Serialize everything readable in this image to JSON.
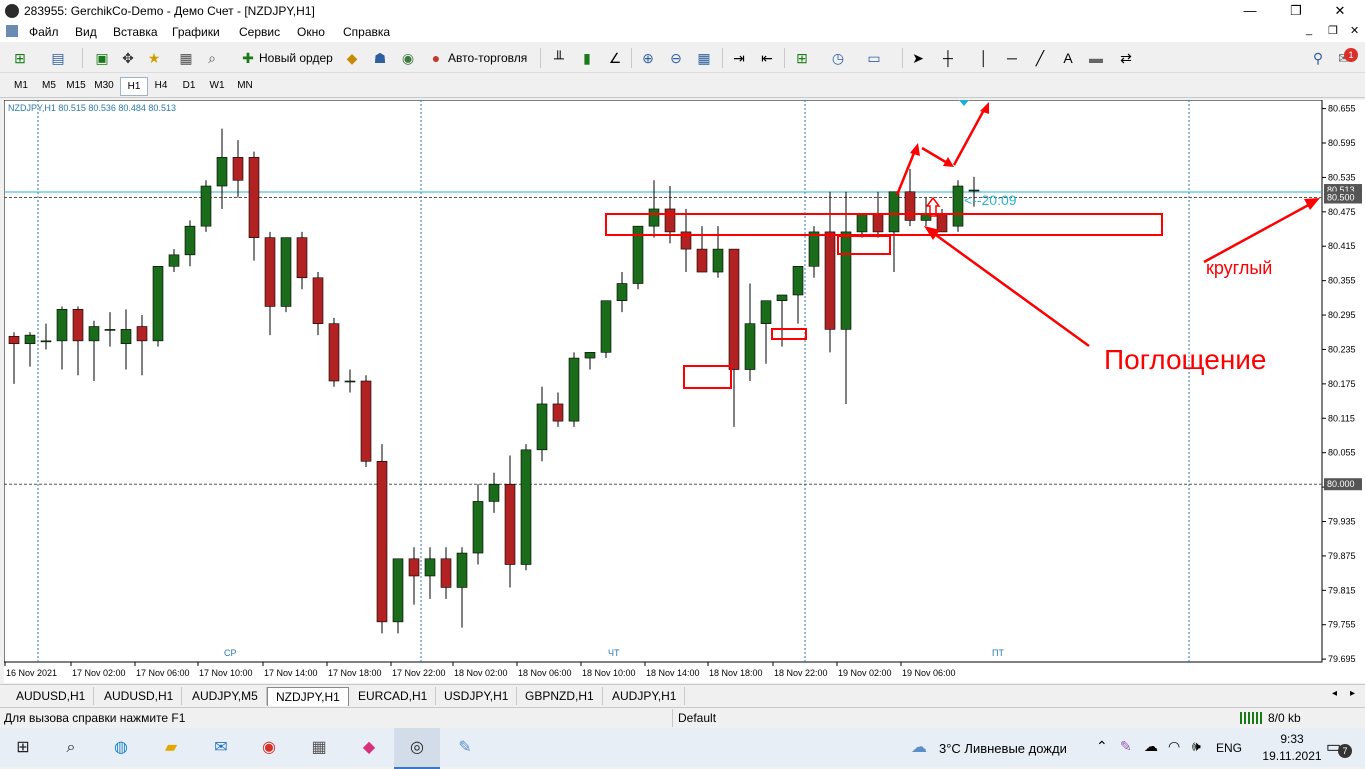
{
  "window": {
    "title": "283955: GerchikCo-Demo - Демо Счет - [NZDJPY,H1]",
    "minimize": "—",
    "maximize": "❐",
    "close": "✕"
  },
  "menu": [
    "Файл",
    "Вид",
    "Вставка",
    "Графики",
    "Сервис",
    "Окно",
    "Справка"
  ],
  "toolbar": {
    "new_order": "Новый ордер",
    "autotrading": "Авто-торговля"
  },
  "timeframes": [
    "M1",
    "M5",
    "M15",
    "M30",
    "H1",
    "H4",
    "D1",
    "W1",
    "MN"
  ],
  "active_timeframe": "H1",
  "chart": {
    "symbol_info": "NZDJPY,H1  80.515 80.536 80.484 80.513",
    "countdown": "<--20:09",
    "price_labels": [
      "80.655",
      "80.595",
      "80.535",
      "80.475",
      "80.415",
      "80.355",
      "80.295",
      "80.235",
      "80.175",
      "80.115",
      "80.055",
      "79.995",
      "79.935",
      "79.875",
      "79.815",
      "79.755",
      "79.695"
    ],
    "current_price_tag": "80.513",
    "level_tag_1": "80.500",
    "level_tag_2": "80.000",
    "time_labels": [
      "16 Nov 2021",
      "17 Nov 02:00",
      "17 Nov 06:00",
      "17 Nov 10:00",
      "17 Nov 14:00",
      "17 Nov 18:00",
      "17 Nov 22:00",
      "18 Nov 02:00",
      "18 Nov 06:00",
      "18 Nov 10:00",
      "18 Nov 14:00",
      "18 Nov 18:00",
      "18 Nov 22:00",
      "19 Nov 02:00",
      "19 Nov 06:00"
    ],
    "day_labels": [
      "СР",
      "ЧТ",
      "ПТ"
    ],
    "annotation_round": "круглый",
    "annotation_engulfing": "Поглощение",
    "colors": {
      "bull": "#1a6b1a",
      "bear": "#b22222",
      "annotation": "#ff0000",
      "grid": "#2a7ab0"
    }
  },
  "chart_data": {
    "type": "candlestick",
    "ylim": [
      79.69,
      80.67
    ],
    "candles": [
      [
        80.258,
        80.265,
        80.175,
        80.245
      ],
      [
        80.245,
        80.265,
        80.205,
        80.26
      ],
      [
        80.25,
        80.28,
        80.235,
        80.25
      ],
      [
        80.25,
        80.31,
        80.2,
        80.305
      ],
      [
        80.305,
        80.31,
        80.19,
        80.25
      ],
      [
        80.25,
        80.285,
        80.18,
        80.275
      ],
      [
        80.27,
        80.3,
        80.24,
        80.27
      ],
      [
        80.245,
        80.305,
        80.2,
        80.27
      ],
      [
        80.275,
        80.295,
        80.19,
        80.25
      ],
      [
        80.25,
        80.35,
        80.24,
        80.38
      ],
      [
        80.38,
        80.41,
        80.37,
        80.4
      ],
      [
        80.4,
        80.46,
        80.38,
        80.45
      ],
      [
        80.45,
        80.53,
        80.44,
        80.52
      ],
      [
        80.52,
        80.62,
        80.48,
        80.57
      ],
      [
        80.57,
        80.6,
        80.5,
        80.53
      ],
      [
        80.57,
        80.58,
        80.39,
        80.43
      ],
      [
        80.43,
        80.44,
        80.26,
        80.31
      ],
      [
        80.31,
        80.43,
        80.3,
        80.43
      ],
      [
        80.43,
        80.44,
        80.34,
        80.36
      ],
      [
        80.36,
        80.37,
        80.26,
        80.28
      ],
      [
        80.28,
        80.29,
        80.17,
        80.18
      ],
      [
        80.18,
        80.2,
        80.16,
        80.18
      ],
      [
        80.18,
        80.19,
        80.03,
        80.04
      ],
      [
        80.04,
        80.07,
        79.74,
        79.76
      ],
      [
        79.76,
        79.84,
        79.74,
        79.87
      ],
      [
        79.87,
        79.89,
        79.79,
        79.84
      ],
      [
        79.84,
        79.89,
        79.8,
        79.87
      ],
      [
        79.87,
        79.89,
        79.8,
        79.82
      ],
      [
        79.82,
        79.89,
        79.75,
        79.88
      ],
      [
        79.88,
        80.0,
        79.86,
        79.97
      ],
      [
        79.97,
        80.02,
        79.95,
        80.0
      ],
      [
        80.0,
        80.05,
        79.82,
        79.86
      ],
      [
        79.86,
        80.07,
        79.85,
        80.06
      ],
      [
        80.06,
        80.17,
        80.04,
        80.14
      ],
      [
        80.14,
        80.16,
        80.1,
        80.11
      ],
      [
        80.11,
        80.23,
        80.1,
        80.22
      ],
      [
        80.22,
        80.23,
        80.2,
        80.23
      ],
      [
        80.23,
        80.32,
        80.22,
        80.32
      ],
      [
        80.32,
        80.37,
        80.3,
        80.35
      ],
      [
        80.35,
        80.45,
        80.34,
        80.45
      ],
      [
        80.45,
        80.53,
        80.43,
        80.48
      ],
      [
        80.48,
        80.52,
        80.42,
        80.44
      ],
      [
        80.44,
        80.48,
        80.37,
        80.41
      ],
      [
        80.41,
        80.45,
        80.37,
        80.37
      ],
      [
        80.37,
        80.45,
        80.36,
        80.41
      ],
      [
        80.41,
        80.37,
        80.1,
        80.2
      ],
      [
        80.2,
        80.35,
        80.18,
        80.28
      ],
      [
        80.28,
        80.3,
        80.21,
        80.32
      ],
      [
        80.32,
        80.32,
        80.24,
        80.33
      ],
      [
        80.33,
        80.38,
        80.28,
        80.38
      ],
      [
        80.38,
        80.45,
        80.36,
        80.44
      ],
      [
        80.44,
        80.51,
        80.23,
        80.27
      ],
      [
        80.27,
        80.51,
        80.14,
        80.44
      ],
      [
        80.44,
        80.47,
        80.43,
        80.47
      ],
      [
        80.47,
        80.51,
        80.43,
        80.44
      ],
      [
        80.44,
        80.51,
        80.37,
        80.51
      ],
      [
        80.51,
        80.55,
        80.45,
        80.46
      ],
      [
        80.46,
        80.5,
        80.45,
        80.47
      ],
      [
        80.47,
        80.48,
        80.44,
        80.44
      ],
      [
        80.45,
        80.53,
        80.44,
        80.52
      ],
      [
        80.513,
        80.536,
        80.484,
        80.513
      ]
    ]
  },
  "tabs": [
    "AUDUSD,H1",
    "AUDUSD,H1",
    "AUDJPY,M5",
    "NZDJPY,H1",
    "EURCAD,H1",
    "USDJPY,H1",
    "GBPNZD,H1",
    "AUDJPY,H1"
  ],
  "active_tab": "NZDJPY,H1",
  "status": {
    "help": "Для вызова справки нажмите F1",
    "profile": "Default",
    "traffic": "8/0 kb"
  },
  "taskbar": {
    "weather": "3°C  Ливневые дожди",
    "lang": "ENG",
    "time": "9:33",
    "date": "19.11.2021",
    "notification_count": "7"
  },
  "notifications_badge": "1"
}
